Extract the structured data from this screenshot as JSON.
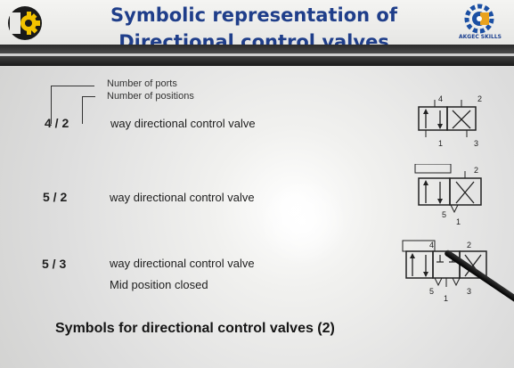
{
  "header": {
    "title_line1": "Symbolic representation of",
    "title_line2": "Directional control valves",
    "right_logo_caption": "AKGEC SKILLS"
  },
  "legend": {
    "ports_label": "Number of ports",
    "positions_label": "Number of positions"
  },
  "rows": [
    {
      "ratio": "4 / 2",
      "description": "way directional control valve",
      "note": ""
    },
    {
      "ratio": "5 / 2",
      "description": "way directional control valve",
      "note": ""
    },
    {
      "ratio": "5 / 3",
      "description": "way directional control valve",
      "note": "Mid position closed"
    }
  ],
  "symbols": {
    "valve_4_2": {
      "ports": [
        "4",
        "2",
        "1",
        "3"
      ]
    },
    "valve_5_2": {
      "ports": [
        "2",
        "5",
        "1"
      ]
    },
    "valve_5_3": {
      "ports": [
        "4",
        "2",
        "5",
        "3",
        "1"
      ]
    }
  },
  "footer": {
    "caption": "Symbols for directional control valves (2)"
  }
}
